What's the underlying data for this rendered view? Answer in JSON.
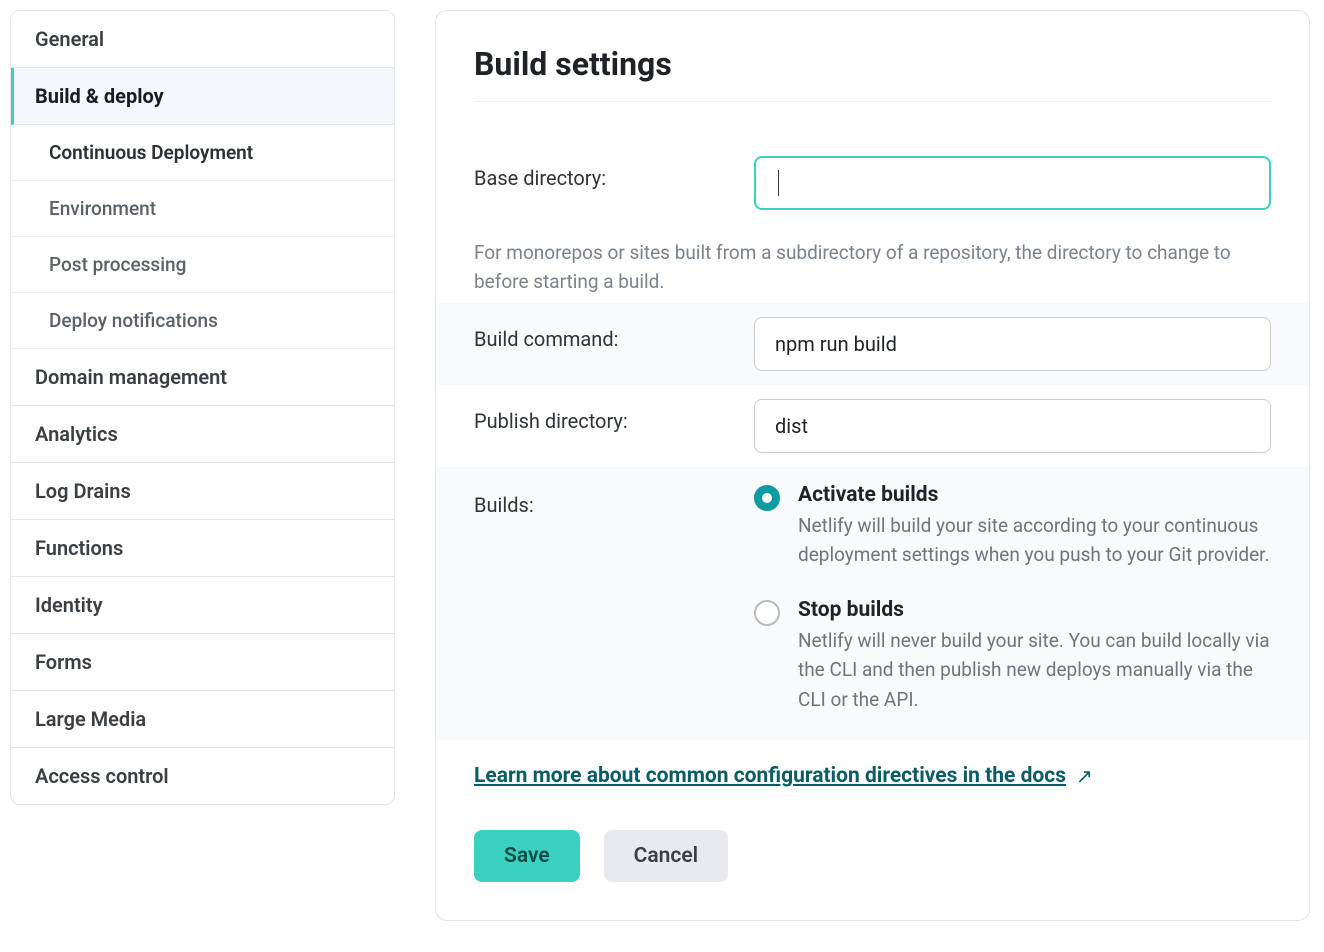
{
  "sidebar": {
    "items": [
      {
        "label": "General"
      },
      {
        "label": "Build & deploy",
        "active": true
      },
      {
        "label": "Domain management"
      },
      {
        "label": "Analytics"
      },
      {
        "label": "Log Drains"
      },
      {
        "label": "Functions"
      },
      {
        "label": "Identity"
      },
      {
        "label": "Forms"
      },
      {
        "label": "Large Media"
      },
      {
        "label": "Access control"
      }
    ],
    "subitems": [
      {
        "label": "Continuous Deployment"
      },
      {
        "label": "Environment"
      },
      {
        "label": "Post processing"
      },
      {
        "label": "Deploy notifications"
      }
    ]
  },
  "panel": {
    "title": "Build settings",
    "fields": {
      "base_directory": {
        "label": "Base directory:",
        "value": "",
        "help": "For monorepos or sites built from a subdirectory of a repository, the directory to change to before starting a build."
      },
      "build_command": {
        "label": "Build command:",
        "value": "npm run build"
      },
      "publish_directory": {
        "label": "Publish directory:",
        "value": "dist"
      },
      "builds": {
        "label": "Builds:",
        "options": {
          "activate": {
            "title": "Activate builds",
            "desc": "Netlify will build your site according to your continuous deployment settings when you push to your Git provider."
          },
          "stop": {
            "title": "Stop builds",
            "desc": "Netlify will never build your site. You can build locally via the CLI and then publish new deploys manually via the CLI or the API."
          }
        }
      }
    },
    "docs_link": "Learn more about common configuration directives in the docs",
    "buttons": {
      "save": "Save",
      "cancel": "Cancel"
    }
  }
}
